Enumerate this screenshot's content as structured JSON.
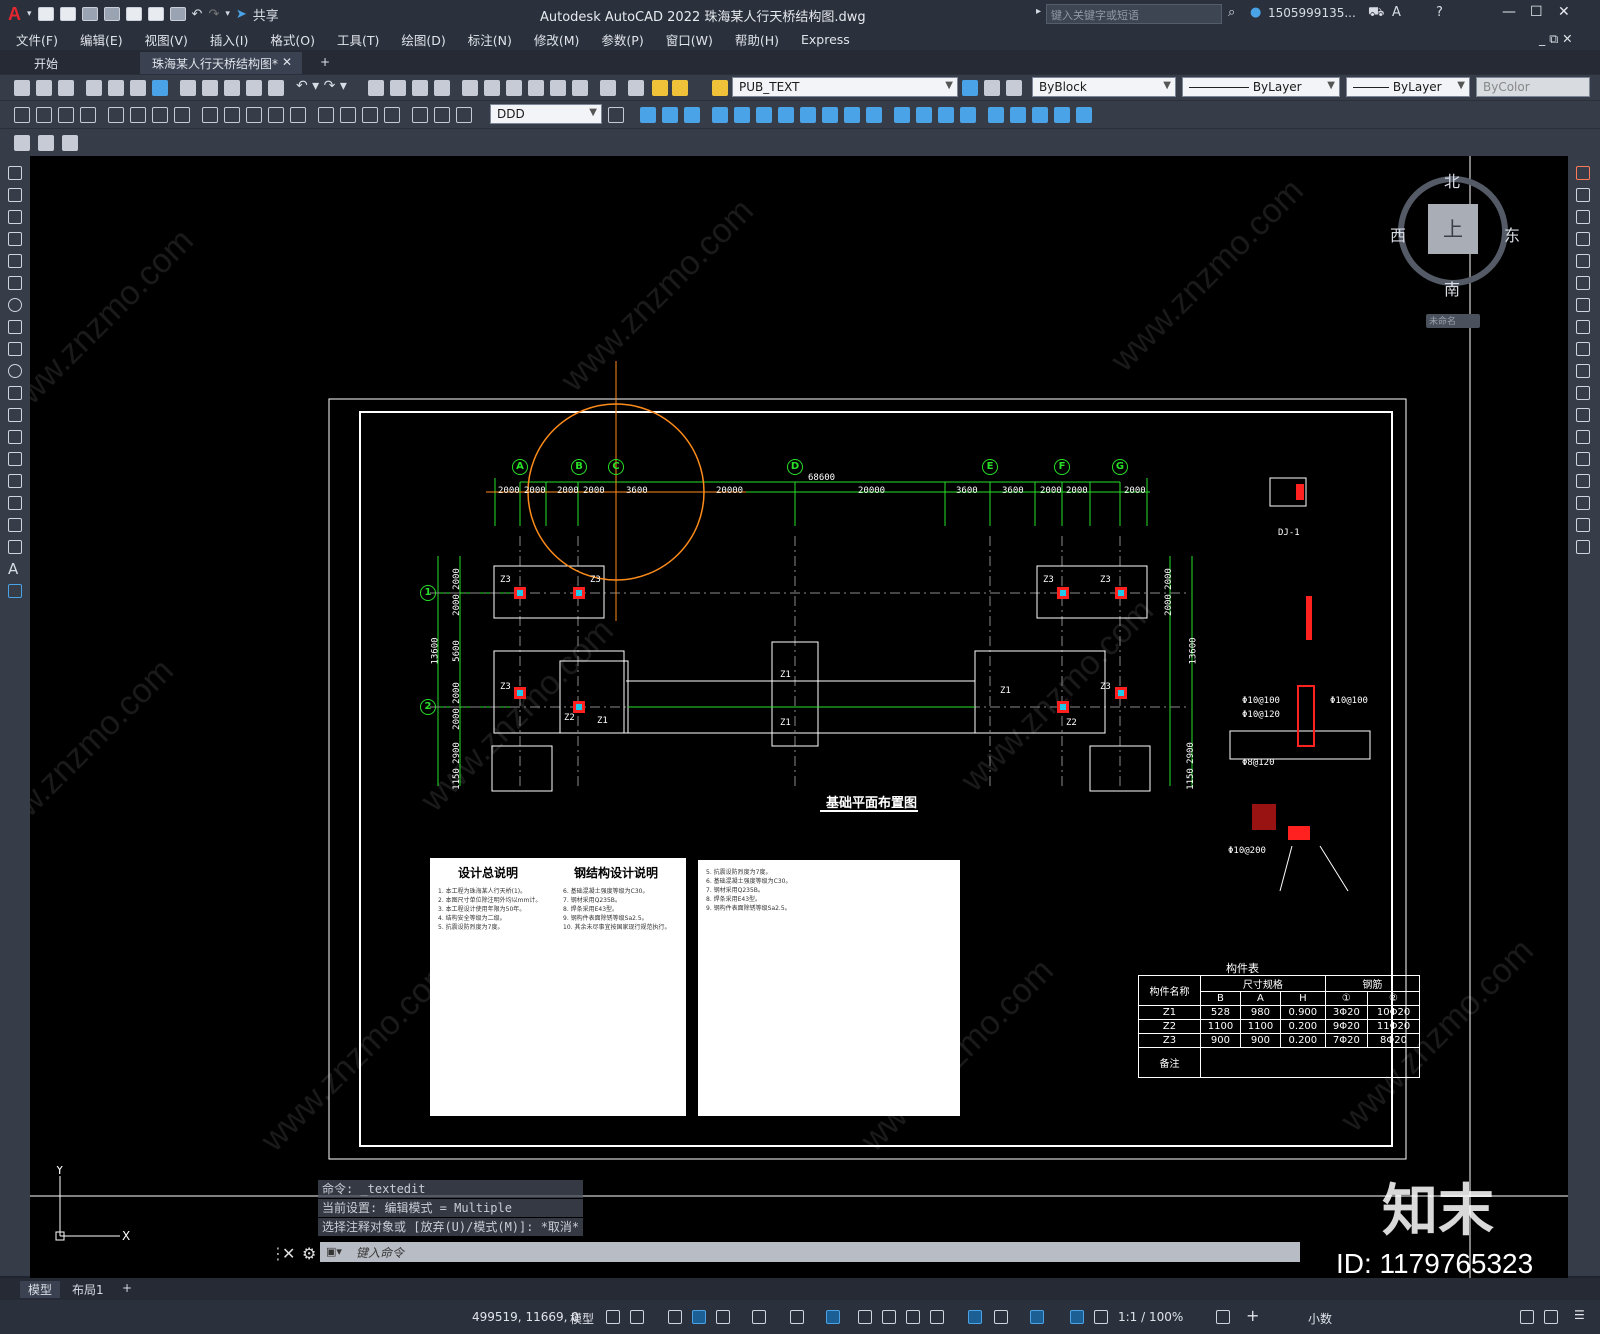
{
  "window": {
    "title": "Autodesk AutoCAD 2022    珠海某人行天桥结构图.dwg",
    "share_label": "共享",
    "search_placeholder": "键入关键字或短语",
    "user": "1505999135...",
    "logo": "A"
  },
  "menu": [
    "文件(F)",
    "编辑(E)",
    "视图(V)",
    "插入(I)",
    "格式(O)",
    "工具(T)",
    "绘图(D)",
    "标注(N)",
    "修改(M)",
    "参数(P)",
    "窗口(W)",
    "帮助(H)",
    "Express"
  ],
  "tabs": {
    "start": "开始",
    "active": "珠海某人行天桥结构图*",
    "add": "+"
  },
  "toolbar": {
    "layer": "PUB_TEXT",
    "color": "ByBlock",
    "linetype": "ByLayer",
    "lineweight": "ByLayer",
    "plotstyle": "ByColor",
    "dimstyle": "DDD"
  },
  "viewcube": {
    "north": "北",
    "south": "南",
    "east": "东",
    "west": "西",
    "top": "上",
    "ucs": "未命名"
  },
  "drawing": {
    "title": "基础平面布置图",
    "grid_top": [
      "A",
      "B",
      "C",
      "D",
      "E",
      "F",
      "G"
    ],
    "grid_left": [
      "1",
      "2"
    ],
    "overall_dim": "68600",
    "top_dims": [
      "2000",
      "2000",
      "2000",
      "2000",
      "3600",
      "20000",
      "20000",
      "3600",
      "3600",
      "2000",
      "2000",
      "2000"
    ],
    "left_dims": [
      "2000",
      "2000",
      "13600",
      "5600",
      "2000",
      "2000",
      "2900",
      "1150"
    ],
    "right_dims": [
      "2000",
      "2000",
      "13600",
      "2900",
      "1150"
    ],
    "footing_labels": [
      "Z3",
      "Z3",
      "Z3",
      "Z2",
      "Z1",
      "Z1",
      "Z1",
      "Z3",
      "Z3",
      "Z1",
      "Z3",
      "Z2"
    ],
    "section_label": "DJ-1",
    "detail_dims": [
      "Φ10@100",
      "Φ10@120",
      "Φ8@120",
      "Φ10@100",
      "Φ10@200"
    ]
  },
  "notes": {
    "sheet1_title_left": "设计总说明",
    "sheet1_title_right": "钢结构设计说明",
    "sheet2_title": "",
    "sample_lines": [
      "1. 本工程为珠海某人行天桥(1)。",
      "2. 本图尺寸单位除注明外均以mm计。",
      "3. 本工程设计使用年限为50年。",
      "4. 结构安全等级为二级。",
      "5. 抗震设防烈度为7度。",
      "6. 基础混凝土强度等级为C30。",
      "7. 钢材采用Q235B。",
      "8. 焊条采用E43型。",
      "9. 钢构件表面除锈等级Sa2.5。",
      "10. 其余未尽事宜按国家现行规范执行。"
    ]
  },
  "component_table": {
    "title": "构件表",
    "headers": [
      "构件名称",
      "尺寸规格",
      "钢筋"
    ],
    "subheaders": [
      "B",
      "A",
      "H",
      "①",
      "②"
    ],
    "rows": [
      [
        "Z1",
        "528",
        "980",
        "0.900",
        "3Φ20",
        "10Φ20"
      ],
      [
        "Z2",
        "1100",
        "1100",
        "0.200",
        "9Φ20",
        "11Φ20"
      ],
      [
        "Z3",
        "900",
        "900",
        "0.200",
        "7Φ20",
        "8Φ20"
      ]
    ],
    "remark": "备注"
  },
  "command": {
    "history": [
      "命令: _textedit",
      "当前设置: 编辑模式 = Multiple",
      "选择注释对象或 [放弃(U)/模式(M)]: *取消*"
    ],
    "placeholder": "键入命令"
  },
  "layout_tabs": [
    "模型",
    "布局1",
    "+"
  ],
  "status": {
    "coords": "499519, 11669, 0",
    "space": "模型",
    "scale": "1:1 / 100%",
    "units": "小数"
  },
  "watermark": {
    "site": "www.znzmo.com",
    "brand": "知末",
    "id": "ID: 1179765323"
  },
  "colors": {
    "grid": "#28e028",
    "orange": "#ff8c1a",
    "red": "#ff2020",
    "cyan": "#23c8e8"
  }
}
